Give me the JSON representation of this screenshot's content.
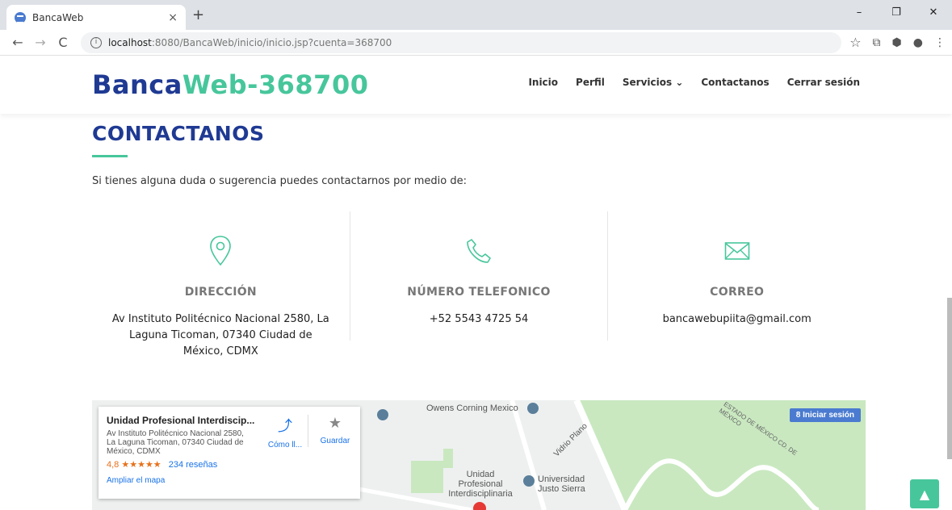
{
  "browser": {
    "tab_title": "BancaWeb",
    "tab_close": "×",
    "new_tab": "+",
    "url_host": "localhost",
    "url_path": ":8080/BancaWeb/inicio/inicio.jsp?cuenta=368700",
    "win_min": "–",
    "win_max": "❐",
    "win_close": "✕"
  },
  "site": {
    "logo_part1": "Banca",
    "logo_part2": "Web",
    "logo_part3": "-368700",
    "menu": [
      "Inicio",
      "Perfil",
      "Servicios ⌄",
      "Contactanos",
      "Cerrar sesión"
    ]
  },
  "contact": {
    "title": "CONTACTANOS",
    "intro": "Si tienes alguna duda o sugerencia puedes contactarnos por medio de:",
    "columns": [
      {
        "label": "DIRECCIÓN",
        "value": "Av Instituto Politécnico Nacional 2580, La Laguna Ticoman, 07340 Ciudad de México, CDMX",
        "icon": "location-pin-icon"
      },
      {
        "label": "NÚMERO TELEFONICO",
        "value": "+52 5543 4725 54",
        "icon": "phone-icon"
      },
      {
        "label": "CORREO",
        "value": "bancawebupiita@gmail.com",
        "icon": "envelope-icon"
      }
    ],
    "accent": "#47c69c",
    "brand": "#1f3a93"
  },
  "map": {
    "place_name": "Unidad Profesional Interdiscip...",
    "place_address": "Av Instituto Politécnico Nacional 2580, La Laguna Ticoman, 07340 Ciudad de México, CDMX",
    "rating": "4,8",
    "stars": "★★★★★",
    "reviews": "234 reseñas",
    "enlarge": "Ampliar el mapa",
    "directions": "Cómo ll...",
    "save": "Guardar",
    "signin": "Iniciar sesión",
    "labels": [
      "Owens Corning Mexico",
      "Vidrio Plano",
      "Unidad Profesional Interdisciplinaria",
      "Universidad Justo Sierra",
      "ESTADO DE MÉXICO CD. DE MÉXICO"
    ]
  }
}
